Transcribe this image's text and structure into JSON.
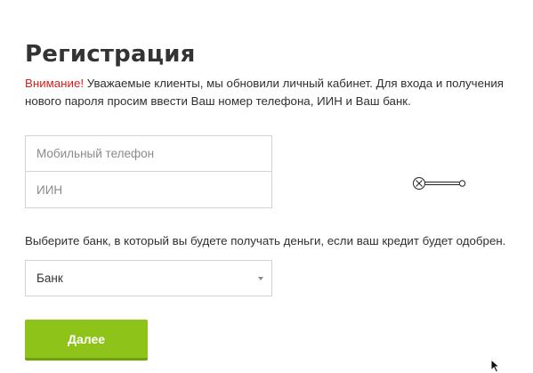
{
  "page": {
    "title": "Регистрация"
  },
  "notice": {
    "warning": "Внимание!",
    "text": " Уважаемые клиенты, мы обновили личный кабинет. Для входа и получения нового пароля просим ввести Ваш номер телефона, ИИН и Ваш банк."
  },
  "form": {
    "phone_placeholder": "Мобильный телефон",
    "phone_value": "",
    "iin_placeholder": "ИИН",
    "iin_value": "",
    "bank_hint": "Выберите банк, в который вы будете получать деньги, если ваш кредит будет одобрен.",
    "bank_selected": "Банк",
    "submit_label": "Далее"
  },
  "icons": {
    "connector": "cancel-connector-icon",
    "cursor": "mouse-pointer-icon",
    "select_arrow": "dropdown-arrow-icon"
  },
  "colors": {
    "warning": "#d81f1f",
    "accent": "#8ec31a",
    "accent_shadow": "#6ea20c",
    "border": "#d2d2d2",
    "title": "#333333"
  }
}
